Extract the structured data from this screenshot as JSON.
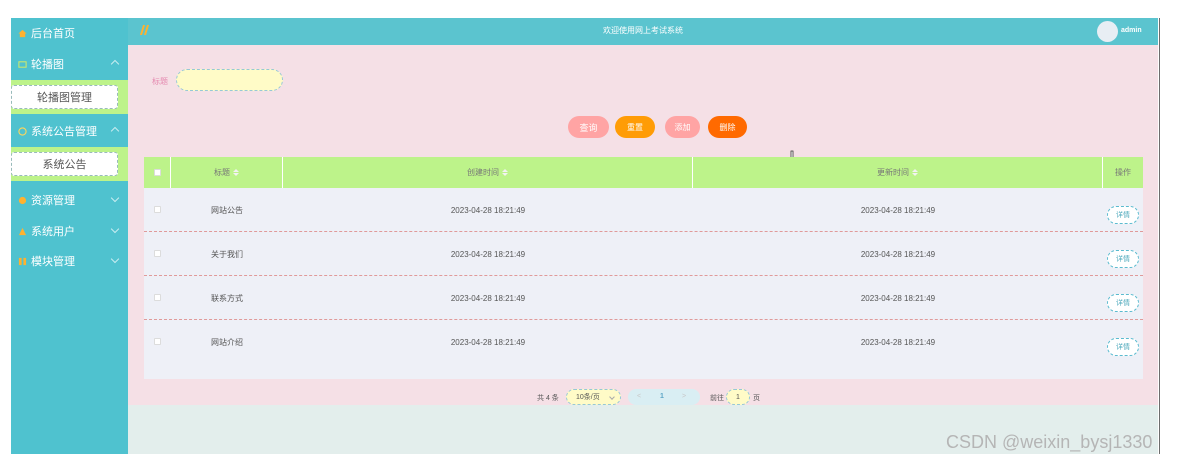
{
  "colors": {
    "sidebar": "#4fc2cf",
    "topbar": "#5bc4cf",
    "submenu_bg": "#bdf38a",
    "content_bg": "#f5e0e6",
    "btn_query": "#ffa4a4",
    "btn_reset": "#ff9c06",
    "btn_add": "#ffa4a4",
    "btn_delete": "#ff6a00"
  },
  "sidebar": {
    "home": {
      "icon": "home-icon",
      "label": "后台首页"
    },
    "groups": [
      {
        "icon": "image-icon",
        "label": "轮播图",
        "sub": "轮播图管理",
        "expanded": true
      },
      {
        "icon": "notice-icon",
        "label": "系统公告管理",
        "sub": "系统公告",
        "expanded": true
      },
      {
        "icon": "resource-icon",
        "label": "资源管理",
        "expanded": false
      },
      {
        "icon": "user-icon",
        "label": "系统用户",
        "expanded": false
      },
      {
        "icon": "module-icon",
        "label": "模块管理",
        "expanded": false
      }
    ]
  },
  "header": {
    "title": "欢迎使用网上考试系统",
    "user": "admin",
    "logo": "logo-icon"
  },
  "search": {
    "label": "标题",
    "placeholder": "",
    "value": ""
  },
  "buttons": {
    "query": "查询",
    "reset": "重置",
    "add": "添加",
    "delete": "删除"
  },
  "table": {
    "columns": [
      "标题",
      "创建时间",
      "更新时间",
      "操作"
    ],
    "rows": [
      {
        "title": "网站公告",
        "created": "2023-04-28 18:21:49",
        "updated": "2023-04-28 18:21:49",
        "action": "详情"
      },
      {
        "title": "关于我们",
        "created": "2023-04-28 18:21:49",
        "updated": "2023-04-28 18:21:49",
        "action": "详情"
      },
      {
        "title": "联系方式",
        "created": "2023-04-28 18:21:49",
        "updated": "2023-04-28 18:21:49",
        "action": "详情"
      },
      {
        "title": "网站介绍",
        "created": "2023-04-28 18:21:49",
        "updated": "2023-04-28 18:21:49",
        "action": "详情"
      }
    ]
  },
  "pagination": {
    "total": "共 4 条",
    "page_size": "10条/页",
    "prev": "<",
    "current": "1",
    "next": ">",
    "goto_label": "前往",
    "goto_value": "1",
    "unit": "页"
  },
  "watermark": "CSDN @weixin_bysj1330"
}
